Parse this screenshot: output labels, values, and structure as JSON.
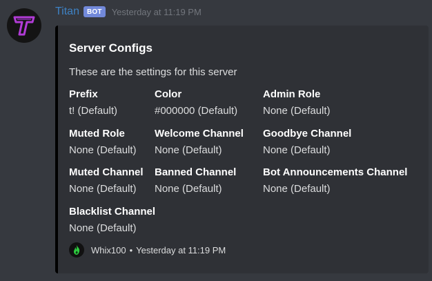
{
  "message": {
    "author": "Titan",
    "badge": "BOT",
    "timestamp": "Yesterday at 11:19 PM",
    "avatar_icon": "titan-logo-icon"
  },
  "embed": {
    "border_color": "#000000",
    "title": "Server Configs",
    "description": "These are the settings for this server",
    "fields": [
      {
        "name": "Prefix",
        "value": "t! (Default)"
      },
      {
        "name": "Color",
        "value": "#000000 (Default)"
      },
      {
        "name": "Admin Role",
        "value": "None (Default)"
      },
      {
        "name": "Muted Role",
        "value": "None (Default)"
      },
      {
        "name": "Welcome Channel",
        "value": "None (Default)"
      },
      {
        "name": "Goodbye Channel",
        "value": "None (Default)"
      },
      {
        "name": "Muted Channel",
        "value": "None (Default)"
      },
      {
        "name": "Banned Channel",
        "value": "None (Default)"
      },
      {
        "name": "Bot Announcements Channel",
        "value": "None (Default)"
      },
      {
        "name": "Blacklist Channel",
        "value": "None (Default)"
      }
    ],
    "footer": {
      "icon": "green-flame-icon",
      "author": "Whix100",
      "separator": "•",
      "timestamp": "Yesterday at 11:19 PM"
    }
  }
}
